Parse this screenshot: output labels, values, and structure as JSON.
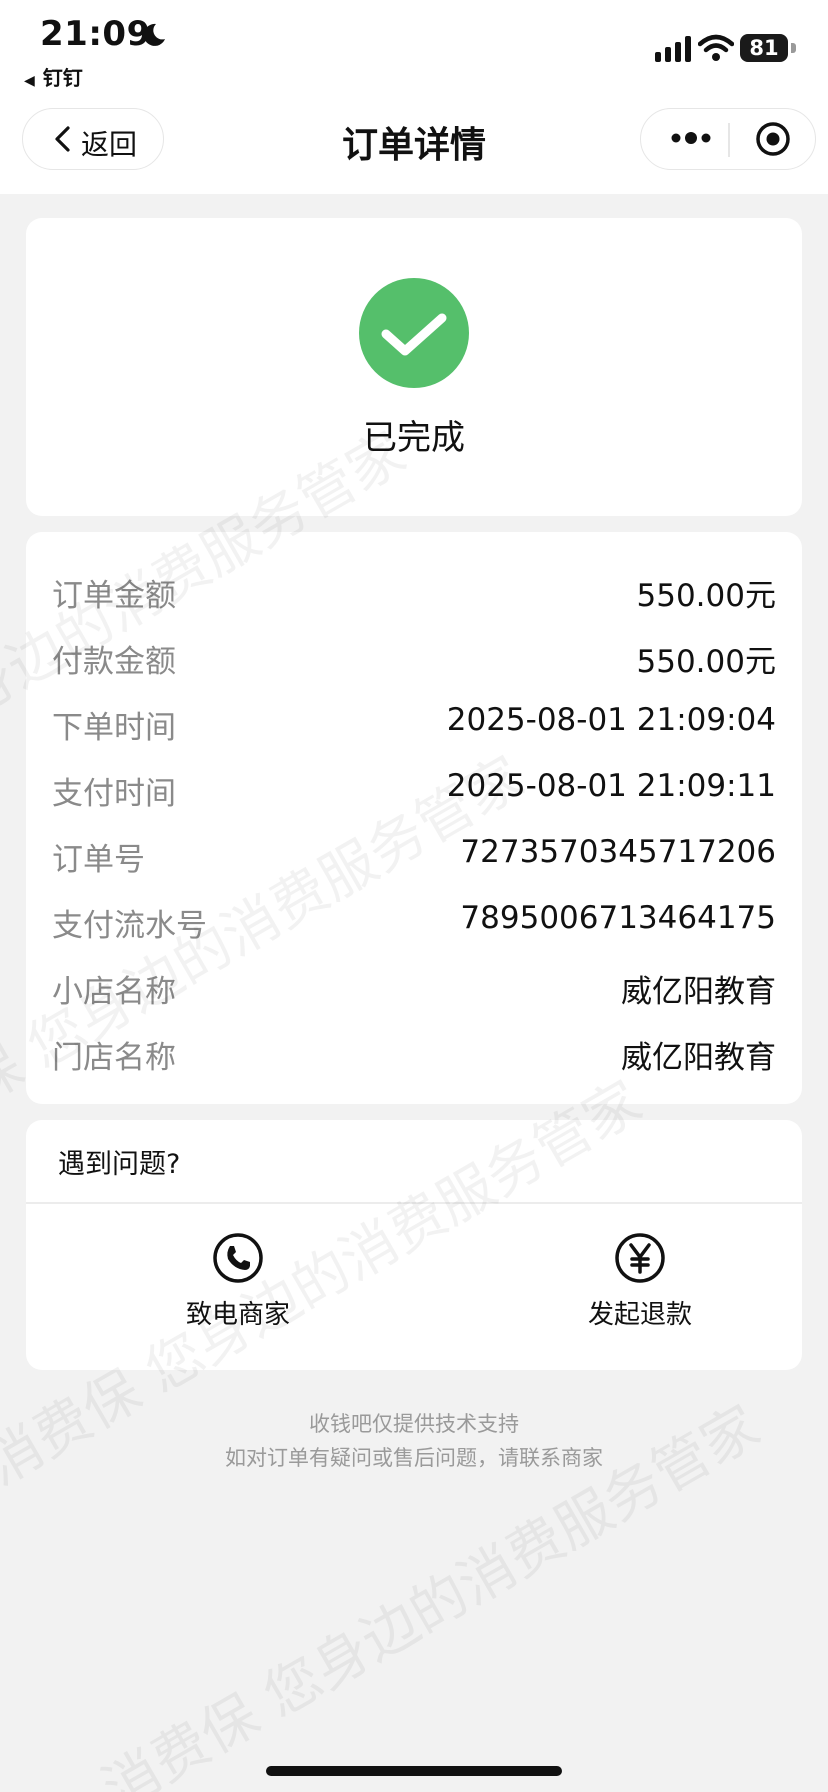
{
  "status_bar": {
    "time": "21:09",
    "back_app": "钉钉",
    "battery": "81"
  },
  "nav": {
    "back_label": "返回",
    "title": "订单详情"
  },
  "order_status": {
    "text": "已完成"
  },
  "details": [
    {
      "label": "订单金额",
      "value": "550.00元"
    },
    {
      "label": "付款金额",
      "value": "550.00元"
    },
    {
      "label": "下单时间",
      "value": "2025-08-01 21:09:04"
    },
    {
      "label": "支付时间",
      "value": "2025-08-01 21:09:11"
    },
    {
      "label": "订单号",
      "value": "7273570345717206"
    },
    {
      "label": "支付流水号",
      "value": "7895006713464175"
    },
    {
      "label": "小店名称",
      "value": "威亿阳教育"
    },
    {
      "label": "门店名称",
      "value": "威亿阳教育"
    }
  ],
  "help": {
    "title": "遇到问题?",
    "call_label": "致电商家",
    "refund_label": "发起退款"
  },
  "footer": {
    "line1": "收钱吧仅提供技术支持",
    "line2": "如对订单有疑问或售后问题，请联系商家"
  },
  "watermark": {
    "text": "消费保 您身边的消费服务管家"
  },
  "colors": {
    "success": "#55bf6b",
    "background": "#f2f2f2",
    "label": "#8a8a8a"
  },
  "icons": [
    "moon-icon",
    "signal-icon",
    "wifi-icon",
    "battery-icon",
    "chevron-left-icon",
    "more-icon",
    "target-icon",
    "check-icon",
    "phone-icon",
    "yuan-icon"
  ]
}
